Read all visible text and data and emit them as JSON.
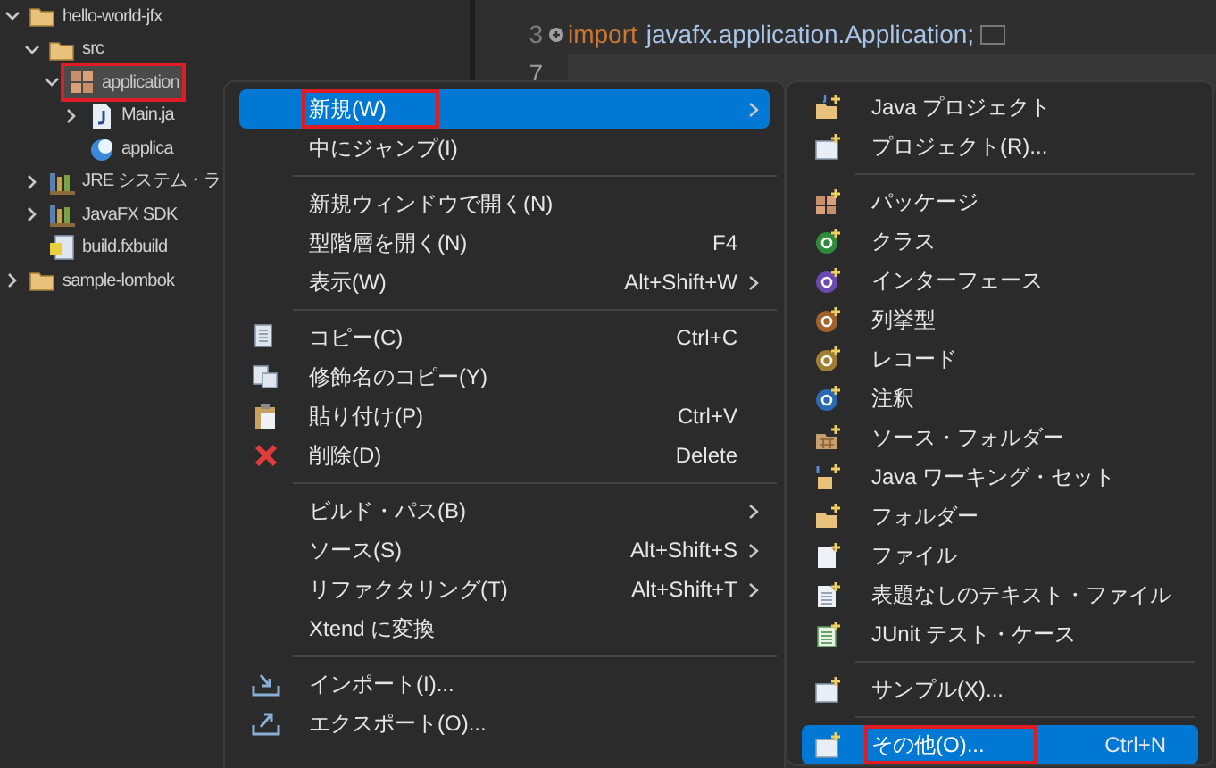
{
  "project_tree": [
    {
      "label": "hello-world-jfx",
      "expanded": true,
      "selected": false,
      "highlighted": false,
      "children": [
        {
          "label": "src",
          "expanded": true,
          "selected": false,
          "highlighted": false,
          "children": [
            {
              "label": "application",
              "expanded": true,
              "selected": true,
              "highlighted": true,
              "children": [
                {
                  "label": "Main.ja",
                  "expanded": false,
                  "selected": false,
                  "highlighted": false
                },
                {
                  "label": "applica",
                  "selected": false,
                  "highlighted": false
                }
              ]
            }
          ]
        },
        {
          "label": "JRE システム・ラ",
          "expanded": false,
          "selected": false,
          "highlighted": false
        },
        {
          "label": "JavaFX SDK",
          "expanded": false,
          "selected": false,
          "highlighted": false
        },
        {
          "label": "build.fxbuild",
          "selected": false,
          "highlighted": false
        }
      ]
    },
    {
      "label": "sample-lombok",
      "expanded": false,
      "selected": false,
      "highlighted": false
    }
  ],
  "editor": {
    "lines": [
      {
        "number": "3",
        "folded": true,
        "keyword": "import",
        "code": "javafx.application.Application;",
        "current": false
      },
      {
        "number": "7",
        "current": true
      }
    ]
  },
  "context_menu": {
    "sections": [
      [
        {
          "label": "新規(W)",
          "submenu": true,
          "selected": true,
          "highlighted": true
        },
        {
          "label": "中にジャンプ(I)",
          "submenu": false,
          "selected": false,
          "highlighted": false
        }
      ],
      [
        {
          "label": "新規ウィンドウで開く(N)",
          "submenu": false,
          "selected": false,
          "highlighted": false
        },
        {
          "label": "型階層を開く(N)",
          "shortcut": "F4",
          "submenu": false,
          "selected": false,
          "highlighted": false
        },
        {
          "label": "表示(W)",
          "shortcut": "Alt+Shift+W",
          "submenu": true,
          "selected": false,
          "highlighted": false
        }
      ],
      [
        {
          "label": "コピー(C)",
          "shortcut": "Ctrl+C",
          "submenu": false,
          "selected": false,
          "highlighted": false
        },
        {
          "label": "修飾名のコピー(Y)",
          "submenu": false,
          "selected": false,
          "highlighted": false
        },
        {
          "label": "貼り付け(P)",
          "shortcut": "Ctrl+V",
          "submenu": false,
          "selected": false,
          "highlighted": false
        },
        {
          "label": "削除(D)",
          "shortcut": "Delete",
          "submenu": false,
          "selected": false,
          "highlighted": false
        }
      ],
      [
        {
          "label": "ビルド・パス(B)",
          "submenu": true,
          "selected": false,
          "highlighted": false
        },
        {
          "label": "ソース(S)",
          "shortcut": "Alt+Shift+S",
          "submenu": true,
          "selected": false,
          "highlighted": false
        },
        {
          "label": "リファクタリング(T)",
          "shortcut": "Alt+Shift+T",
          "submenu": true,
          "selected": false,
          "highlighted": false
        },
        {
          "label": "Xtend に変換",
          "submenu": false,
          "selected": false,
          "highlighted": false
        }
      ],
      [
        {
          "label": "インポート(I)...",
          "submenu": false,
          "selected": false,
          "highlighted": false
        },
        {
          "label": "エクスポート(O)...",
          "submenu": false,
          "selected": false,
          "highlighted": false
        }
      ]
    ]
  },
  "new_submenu": {
    "sections": [
      [
        {
          "label": "Java プロジェクト",
          "selected": false,
          "highlighted": false
        },
        {
          "label": "プロジェクト(R)...",
          "selected": false,
          "highlighted": false
        }
      ],
      [
        {
          "label": "パッケージ",
          "selected": false,
          "highlighted": false
        },
        {
          "label": "クラス",
          "selected": false,
          "highlighted": false
        },
        {
          "label": "インターフェース",
          "selected": false,
          "highlighted": false
        },
        {
          "label": "列挙型",
          "selected": false,
          "highlighted": false
        },
        {
          "label": "レコード",
          "selected": false,
          "highlighted": false
        },
        {
          "label": "注釈",
          "selected": false,
          "highlighted": false
        },
        {
          "label": "ソース・フォルダー",
          "selected": false,
          "highlighted": false
        },
        {
          "label": "Java ワーキング・セット",
          "selected": false,
          "highlighted": false
        },
        {
          "label": "フォルダー",
          "selected": false,
          "highlighted": false
        },
        {
          "label": "ファイル",
          "selected": false,
          "highlighted": false
        },
        {
          "label": "表題なしのテキスト・ファイル",
          "selected": false,
          "highlighted": false
        },
        {
          "label": "JUnit テスト・ケース",
          "selected": false,
          "highlighted": false
        }
      ],
      [
        {
          "label": "サンプル(X)...",
          "selected": false,
          "highlighted": false
        }
      ],
      [
        {
          "label": "その他(O)...",
          "shortcut": "Ctrl+N",
          "selected": true,
          "highlighted": true
        }
      ]
    ]
  }
}
